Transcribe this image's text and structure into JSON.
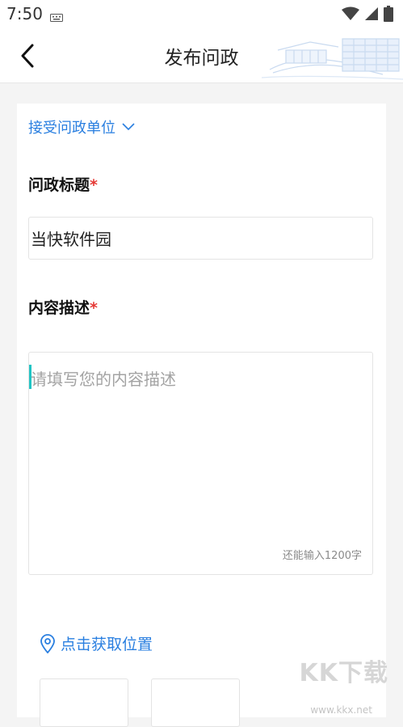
{
  "status_bar": {
    "time": "7:50",
    "icons": [
      "keyboard-icon",
      "wifi-icon",
      "signal-icon",
      "battery-icon"
    ]
  },
  "header": {
    "title": "发布问政",
    "back_icon": "back-arrow-icon"
  },
  "form": {
    "unit_select_label": "接受问政单位",
    "title_label": "问政标题",
    "required_mark": "*",
    "title_value": "当快软件园",
    "content_label": "内容描述",
    "content_placeholder": "请填写您的内容描述",
    "char_limit_text": "还能输入1200字",
    "location_label": "点击获取位置"
  },
  "watermark": {
    "text": "KK下载",
    "url": "www.kkx.net"
  },
  "colors": {
    "accent": "#2a7fe0",
    "required": "#e53935",
    "background": "#f4f4f4",
    "cursor": "#21c4c4"
  }
}
